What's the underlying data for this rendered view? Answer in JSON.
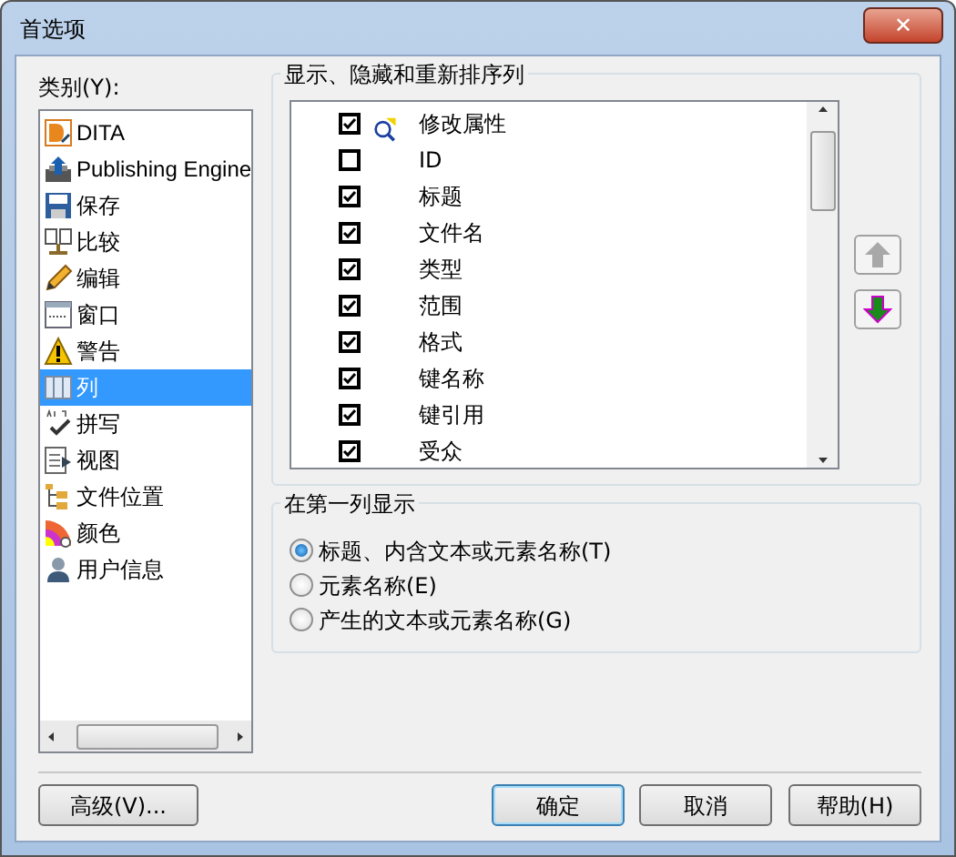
{
  "window": {
    "title": "首选项",
    "close": "✕"
  },
  "categories": {
    "label": "类别(Y):",
    "items": [
      {
        "label": "DITA",
        "selected": false
      },
      {
        "label": "Publishing Engine",
        "selected": false
      },
      {
        "label": "保存",
        "selected": false
      },
      {
        "label": "比较",
        "selected": false
      },
      {
        "label": "编辑",
        "selected": false
      },
      {
        "label": "窗口",
        "selected": false
      },
      {
        "label": "警告",
        "selected": false
      },
      {
        "label": "列",
        "selected": true
      },
      {
        "label": "拼写",
        "selected": false
      },
      {
        "label": "视图",
        "selected": false
      },
      {
        "label": "文件位置",
        "selected": false
      },
      {
        "label": "颜色",
        "selected": false
      },
      {
        "label": "用户信息",
        "selected": false
      }
    ]
  },
  "columns_group": {
    "title": "显示、隐藏和重新排序列",
    "items": [
      {
        "label": "修改属性",
        "checked": true,
        "kind": "icon"
      },
      {
        "label": "ID",
        "checked": false,
        "kind": "plain"
      },
      {
        "label": "标题",
        "checked": true,
        "kind": "plain"
      },
      {
        "label": "文件名",
        "checked": true,
        "kind": "plain"
      },
      {
        "label": "类型",
        "checked": true,
        "kind": "plain"
      },
      {
        "label": "范围",
        "checked": true,
        "kind": "plain"
      },
      {
        "label": "格式",
        "checked": true,
        "kind": "plain"
      },
      {
        "label": "键名称",
        "checked": true,
        "kind": "plain"
      },
      {
        "label": "键引用",
        "checked": true,
        "kind": "plain"
      },
      {
        "label": "受众",
        "checked": true,
        "kind": "plain"
      }
    ],
    "move_up_disabled": true,
    "move_down_disabled": false
  },
  "first_column_group": {
    "title": "在第一列显示",
    "options": [
      {
        "label": "标题、内含文本或元素名称(T)",
        "selected": true
      },
      {
        "label": "元素名称(E)",
        "selected": false
      },
      {
        "label": "产生的文本或元素名称(G)",
        "selected": false
      }
    ]
  },
  "buttons": {
    "advanced": "高级(V)...",
    "ok": "确定",
    "cancel": "取消",
    "help": "帮助(H)"
  }
}
